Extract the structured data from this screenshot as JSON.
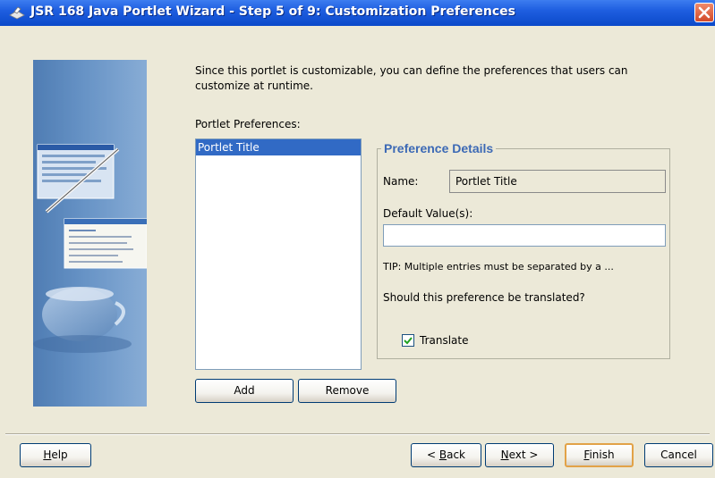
{
  "window": {
    "title": "JSR 168 Java Portlet Wizard - Step 5 of 9: Customization Preferences"
  },
  "intro_text": "Since this portlet is customizable, you can define the preferences that users can customize at runtime.",
  "preferences_list": {
    "label": "Portlet Preferences:",
    "items": [
      {
        "label": "Portlet Title",
        "selected": true
      }
    ]
  },
  "list_buttons": {
    "add": "Add",
    "remove": "Remove"
  },
  "details": {
    "title": "Preference Details",
    "name_label": "Name:",
    "name_value": "Portlet Title",
    "default_label": "Default Value(s):",
    "default_value": "",
    "tip": "TIP: Multiple entries must be separated by a ...",
    "translate_question": "Should this preference be translated?",
    "translate_label": "Translate",
    "translate_checked": true
  },
  "footer": {
    "help_mnemonic": "H",
    "help_rest": "elp",
    "back_prefix": "< ",
    "back_mnemonic": "B",
    "back_rest": "ack",
    "next_mnemonic": "N",
    "next_rest": "ext >",
    "finish_mnemonic": "F",
    "finish_rest": "inish",
    "cancel": "Cancel"
  },
  "colors": {
    "title_bar": "#0b49c9",
    "accent": "#3c69b5",
    "selection": "#316ac5"
  },
  "icons": [
    "wizard-icon",
    "close-icon",
    "checkbox-checked-icon",
    "wizard-side-illustration"
  ]
}
